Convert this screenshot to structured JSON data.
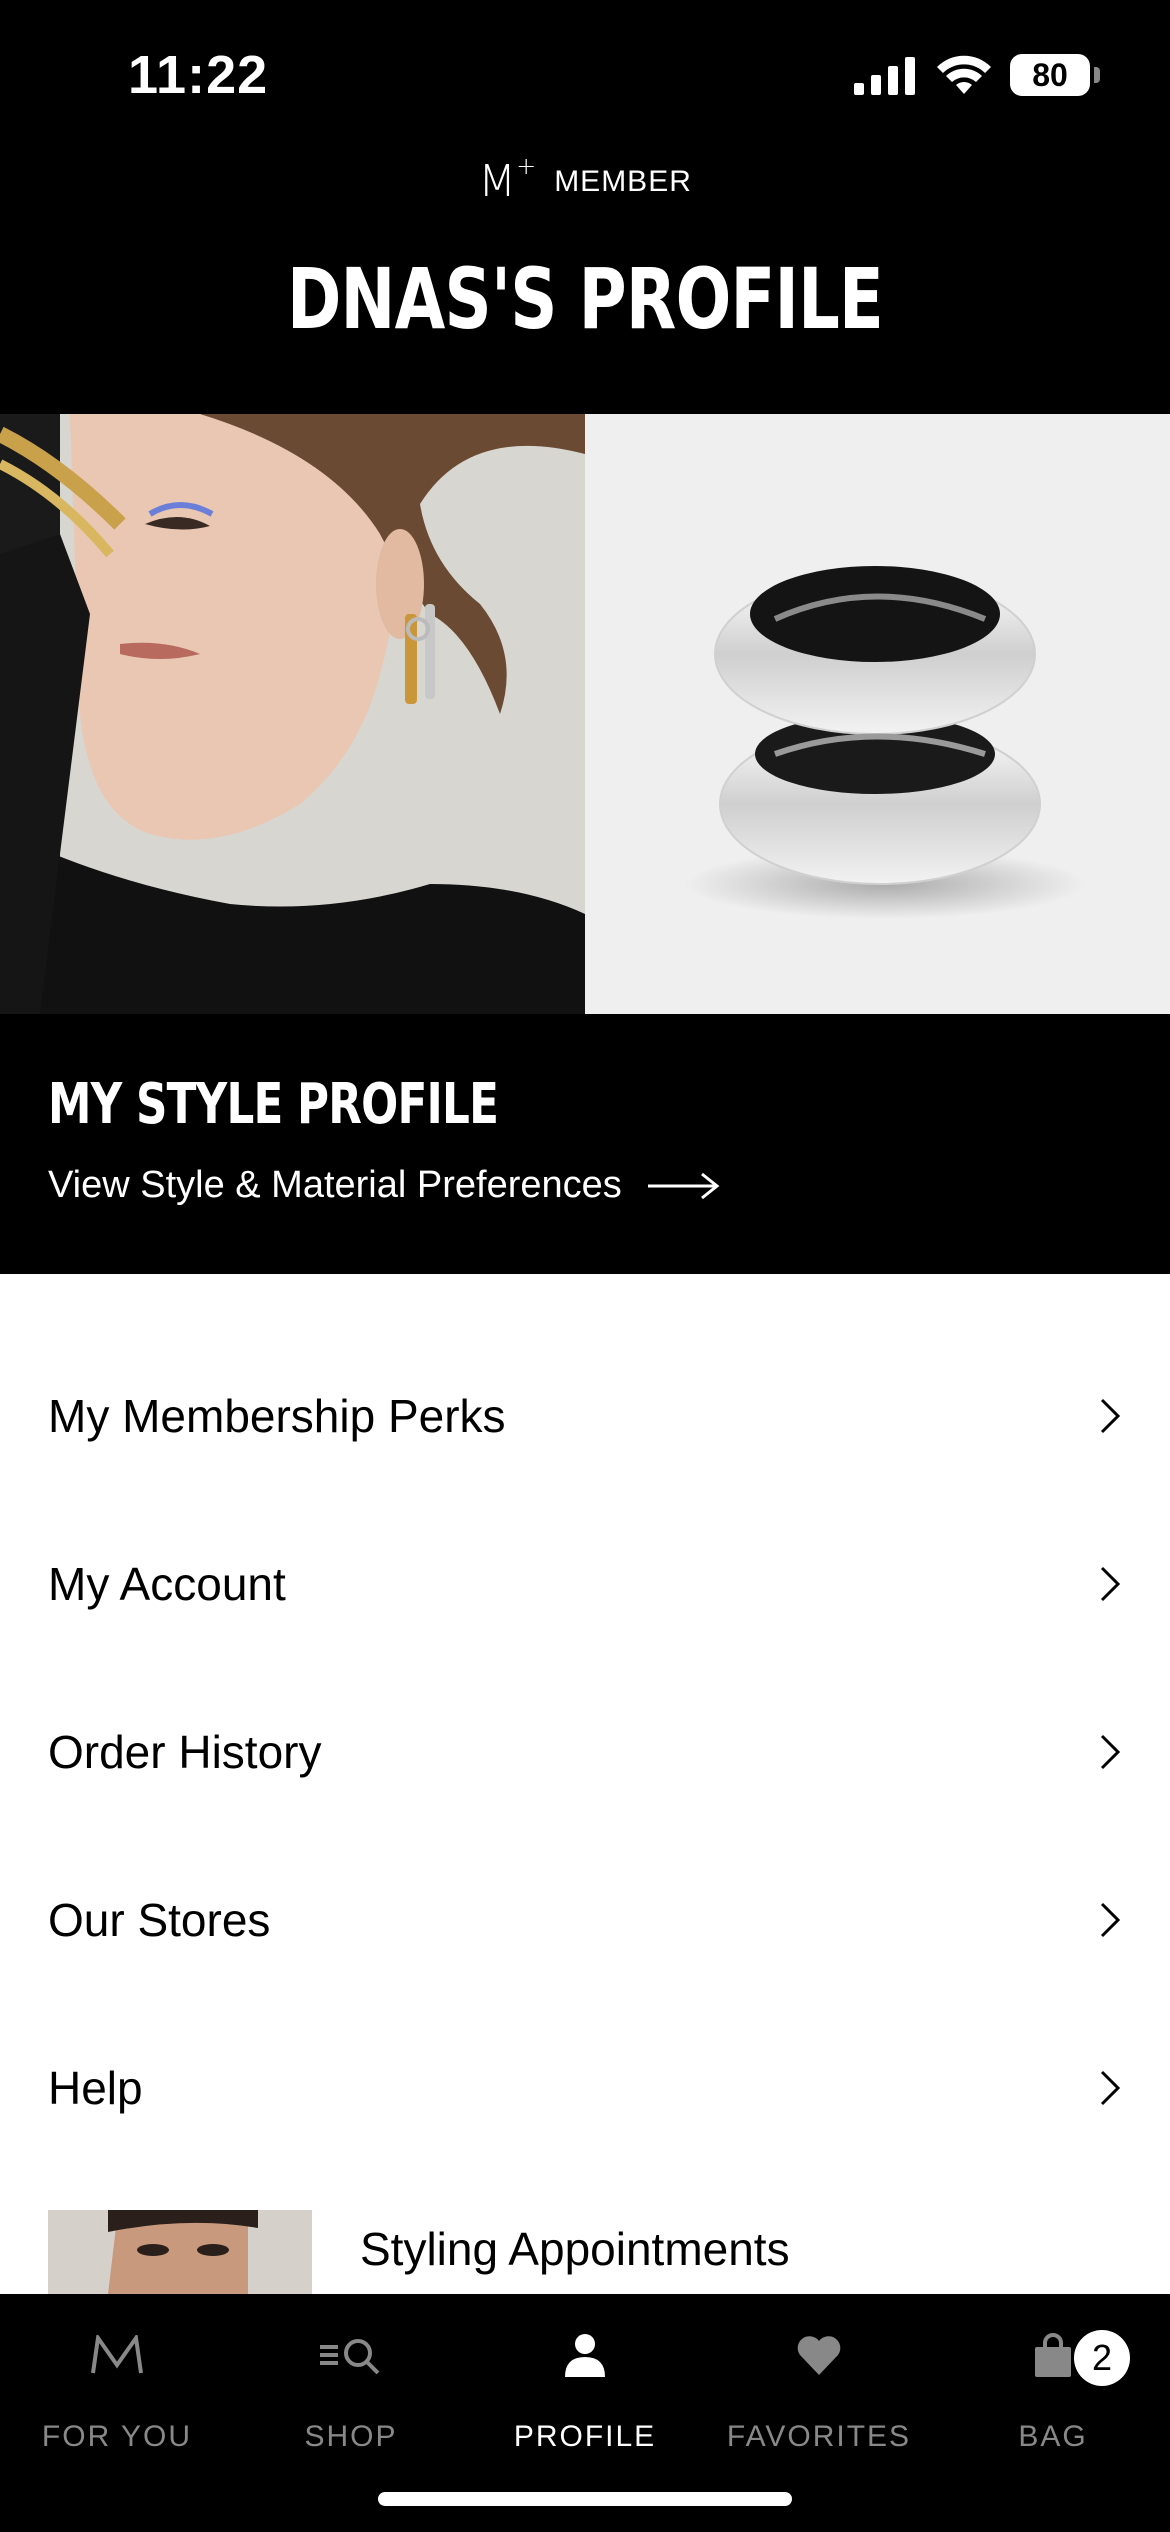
{
  "status_bar": {
    "time": "11:22",
    "battery": "80"
  },
  "header": {
    "member_logo": "M",
    "member_logo_plus": "+",
    "member_label": "MEMBER",
    "title": "DNAS'S PROFILE"
  },
  "style_profile": {
    "title": "MY STYLE PROFILE",
    "link_label": "View Style & Material Preferences"
  },
  "menu": {
    "items": [
      {
        "label": "My Membership Perks"
      },
      {
        "label": "My Account"
      },
      {
        "label": "Order History"
      },
      {
        "label": "Our Stores"
      },
      {
        "label": "Help"
      }
    ]
  },
  "appointment": {
    "title": "Styling Appointments"
  },
  "tabbar": {
    "tabs": [
      {
        "label": "FOR YOU",
        "icon": "m-logo-icon"
      },
      {
        "label": "SHOP",
        "icon": "menu-search-icon"
      },
      {
        "label": "PROFILE",
        "icon": "person-icon",
        "active": true
      },
      {
        "label": "FAVORITES",
        "icon": "heart-icon"
      },
      {
        "label": "BAG",
        "icon": "bag-icon",
        "badge": "2"
      }
    ]
  },
  "colors": {
    "background_dark": "#000000",
    "text_light": "#ffffff",
    "tab_inactive": "#888888"
  }
}
